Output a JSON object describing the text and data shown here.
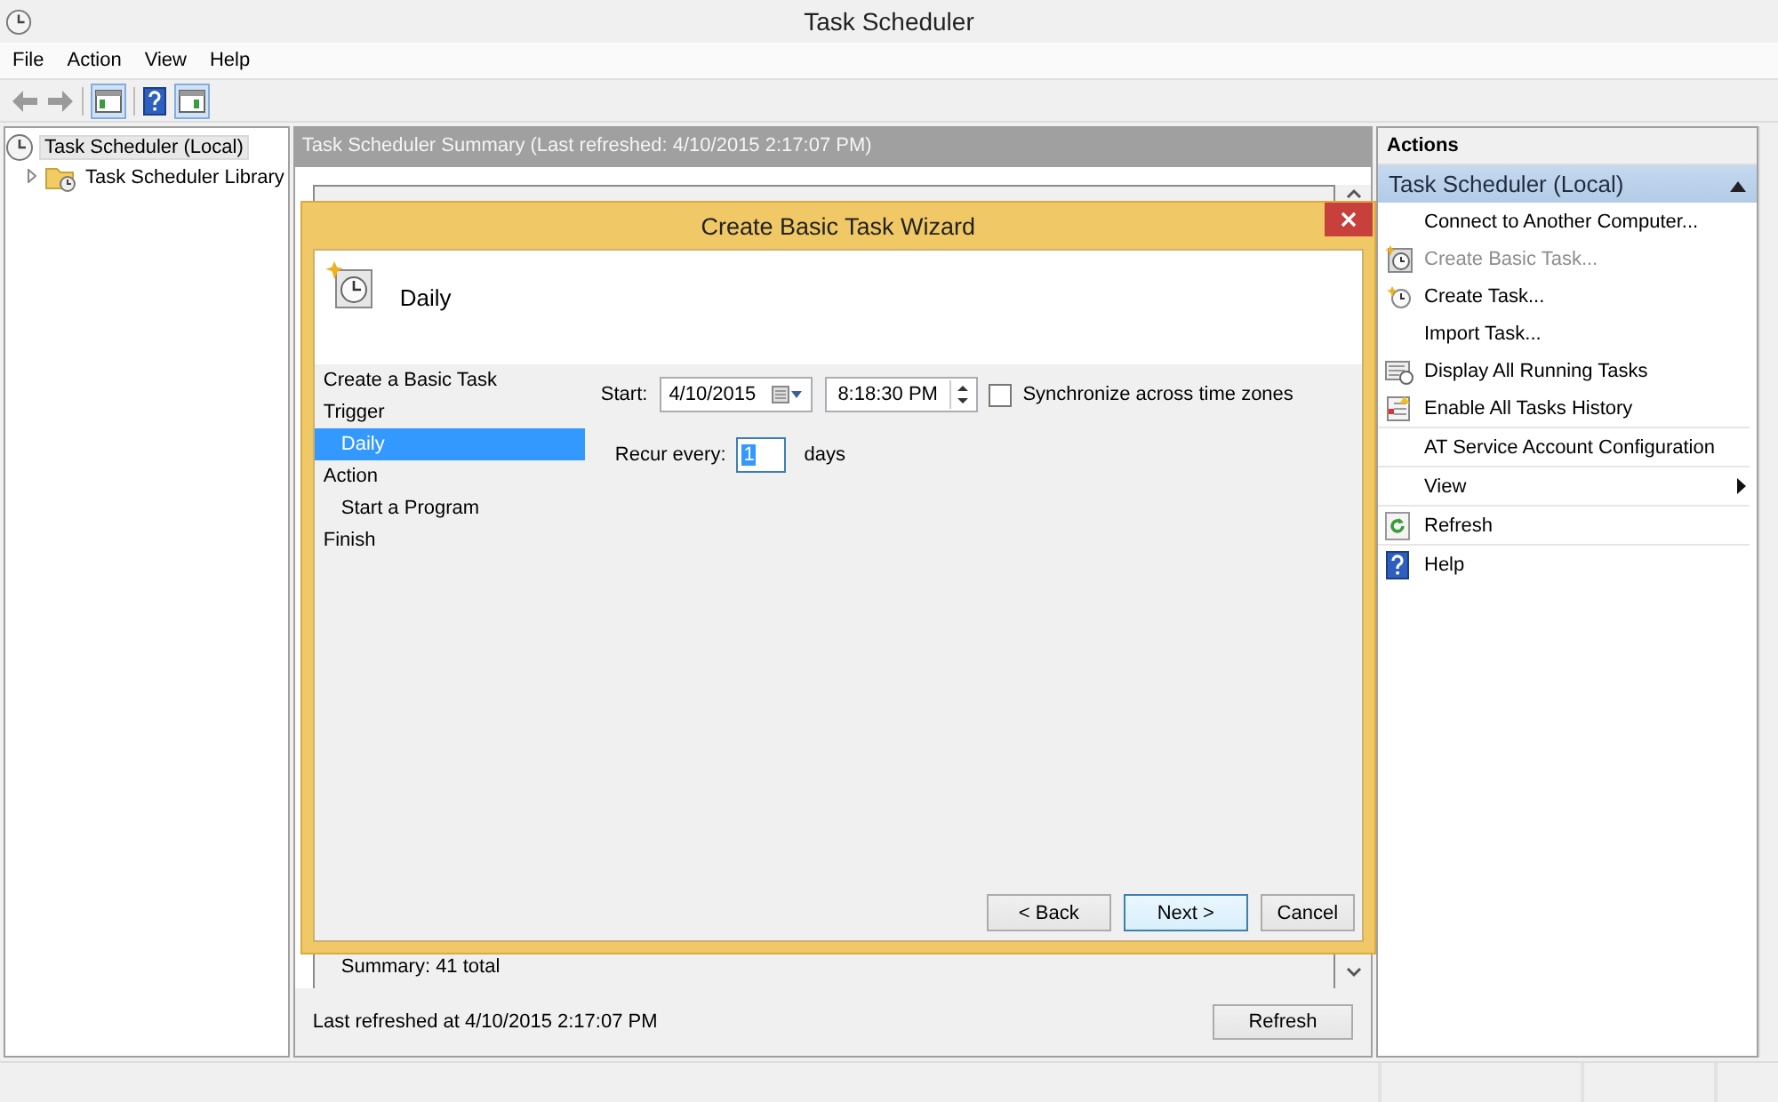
{
  "window": {
    "title": "Task Scheduler"
  },
  "menu": [
    "File",
    "Action",
    "View",
    "Help"
  ],
  "tree": [
    {
      "label": "Task Scheduler (Local)",
      "selected": true,
      "children": [
        {
          "label": "Task Scheduler Library",
          "selected": false,
          "expanded": false
        }
      ]
    }
  ],
  "summary": {
    "header": "Task Scheduler Summary (Last refreshed: 4/10/2015 2:17:07 PM)",
    "total": "Summary: 41 total",
    "last_refreshed": "Last refreshed at 4/10/2015 2:17:07 PM",
    "refresh_button": "Refresh"
  },
  "wizard": {
    "title": "Create Basic Task Wizard",
    "heading": "Daily",
    "steps": [
      {
        "label": "Create a Basic Task",
        "selected": false
      },
      {
        "label": "Trigger",
        "selected": false,
        "children": [
          {
            "label": "Daily",
            "selected": true
          }
        ]
      },
      {
        "label": "Action",
        "selected": false,
        "children": [
          {
            "label": "Start a Program",
            "selected": false
          }
        ]
      },
      {
        "label": "Finish",
        "selected": false
      }
    ],
    "start_label": "Start:",
    "date": "4/10/2015",
    "time": "8:18:30 PM",
    "sync": {
      "label": "Synchronize across time zones",
      "checked": false
    },
    "recur_label": "Recur every:",
    "recur_value": "1",
    "recur_unit": "days",
    "buttons": [
      {
        "label": "< Back",
        "default": false
      },
      {
        "label": "Next >",
        "default": true
      },
      {
        "label": "Cancel",
        "default": false
      }
    ]
  },
  "actions": {
    "header": "Actions",
    "section": "Task Scheduler (Local)",
    "expanded": true,
    "items": [
      {
        "label": "Connect to Another Computer...",
        "disabled": false,
        "submenu": false
      },
      {
        "label": "Create Basic Task...",
        "disabled": true,
        "submenu": false
      },
      {
        "label": "Create Task...",
        "disabled": false,
        "submenu": false
      },
      {
        "label": "Import Task...",
        "disabled": false,
        "submenu": false
      },
      {
        "label": "Display All Running Tasks",
        "disabled": false,
        "submenu": false
      },
      {
        "label": "Enable All Tasks History",
        "disabled": false,
        "submenu": false
      },
      {
        "label": "AT Service Account Configuration",
        "disabled": false,
        "submenu": false
      },
      {
        "label": "View",
        "disabled": false,
        "submenu": true
      },
      {
        "label": "Refresh",
        "disabled": false,
        "submenu": false
      },
      {
        "label": "Help",
        "disabled": false,
        "submenu": false
      }
    ]
  }
}
